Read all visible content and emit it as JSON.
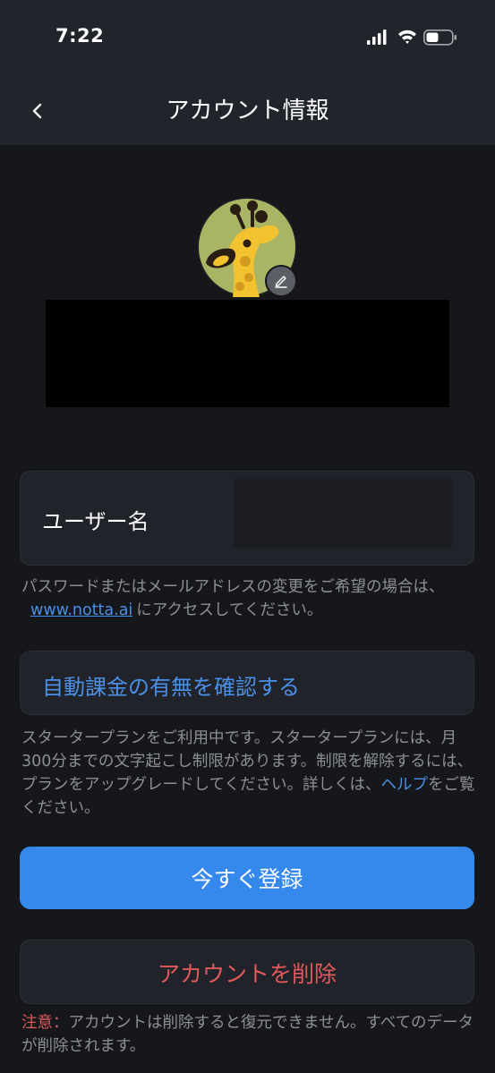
{
  "status_bar": {
    "time": "7:22",
    "icons": [
      "signal-icon",
      "wifi-icon",
      "battery-icon"
    ]
  },
  "header": {
    "title": "アカウント情報",
    "back_icon": "chevron-left-icon"
  },
  "profile": {
    "avatar_icon": "giraffe-avatar-icon",
    "edit_icon": "pencil-icon"
  },
  "username": {
    "label": "ユーザー名"
  },
  "password_note": {
    "text_before": "パスワードまたはメールアドレスの変更をご希望の場合は、",
    "link_text": "www.notta.ai",
    "text_after": "にアクセスしてください。"
  },
  "billing": {
    "label": "自動課金の有無を確認する"
  },
  "plan_note": {
    "text_before": "スタータープランをご利用中です。スタータープランには、月300分までの文字起こし制限があります。制限を解除するには、プランをアップグレードしてください。詳しくは、",
    "link_text": "ヘルプ",
    "text_after": "をご覧ください。"
  },
  "register_button": {
    "label": "今すぐ登録"
  },
  "delete_button": {
    "label": "アカウントを削除"
  },
  "delete_warning": {
    "prefix": "注意：",
    "text": "アカウントは削除すると復元できません。すべてのデータが削除されます。"
  },
  "colors": {
    "background": "#16171b",
    "header": "#20242b",
    "card": "#20232a",
    "accent": "#3588ec",
    "link": "#4a8fe8",
    "danger": "#e05a5a"
  }
}
